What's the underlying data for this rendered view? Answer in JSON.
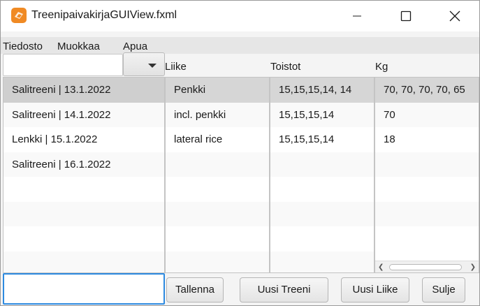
{
  "window": {
    "title": "TreenipaivakirjaGUIView.fxml",
    "controls": {
      "minimize": "minimize-icon",
      "maximize": "maximize-icon",
      "close": "close-icon"
    }
  },
  "menu": [
    "Tiedosto",
    "Muokkaa",
    "Apua"
  ],
  "search": {
    "value": "",
    "combo_icon": "dropdown-arrow-icon"
  },
  "columns": {
    "liike": "Liike",
    "toistot": "Toistot",
    "kg": "Kg"
  },
  "sessions": [
    "Salitreeni | 13.1.2022",
    "Salitreeni | 14.1.2022",
    "Lenkki | 15.1.2022",
    "Salitreeni | 16.1.2022"
  ],
  "liike": [
    "Penkki",
    "incl. penkki",
    "lateral rice"
  ],
  "toistot": [
    "15,15,15,14, 14",
    "15,15,15,14",
    "15,15,15,14"
  ],
  "kg": [
    "70, 70, 70, 70, 65",
    "70",
    "18"
  ],
  "buttons": {
    "tallenna": "Tallenna",
    "uusi_treeni": "Uusi Treeni",
    "uusi_liike": "Uusi Liike",
    "sulje": "Sulje"
  },
  "colors": {
    "accent": "#2d8ae0",
    "app_icon": "#f08a24",
    "selection": "#d6d6d6"
  }
}
